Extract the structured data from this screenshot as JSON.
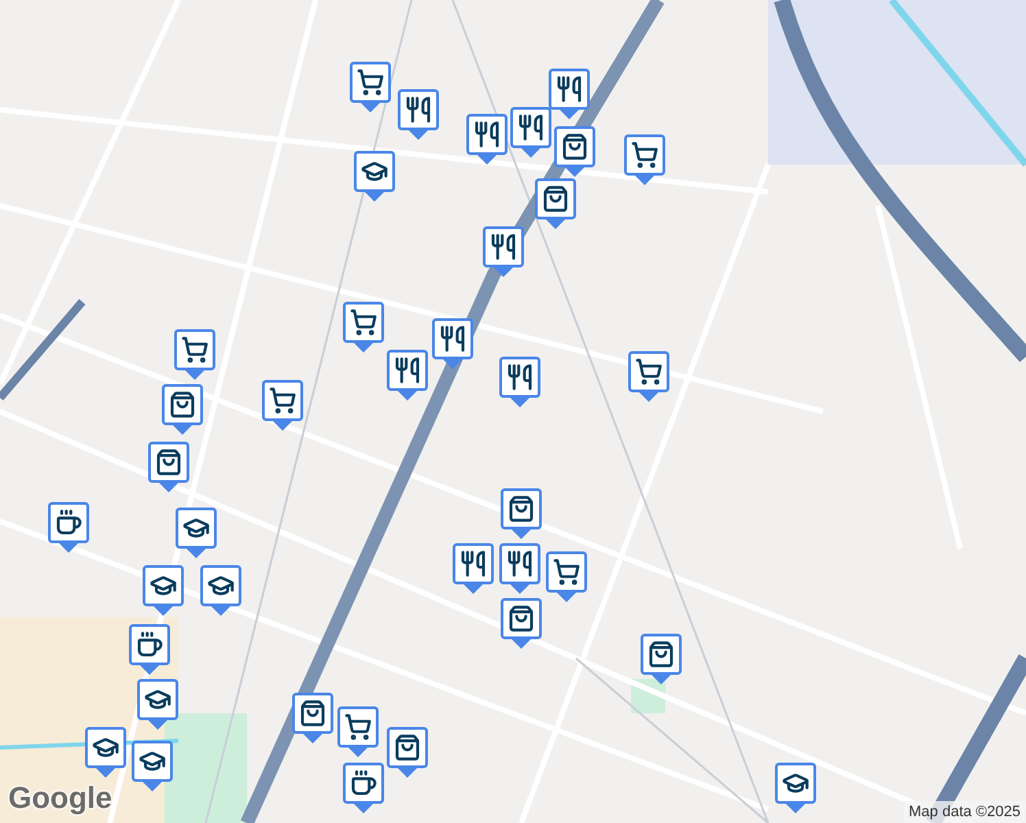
{
  "map": {
    "markers": [
      {
        "kind": "cart"
      },
      {
        "kind": "food"
      },
      {
        "kind": "food"
      },
      {
        "kind": "food"
      },
      {
        "kind": "food"
      },
      {
        "kind": "bag"
      },
      {
        "kind": "bag"
      },
      {
        "kind": "school"
      },
      {
        "kind": "cart"
      },
      {
        "kind": "food"
      },
      {
        "kind": "cart"
      },
      {
        "kind": "food"
      },
      {
        "kind": "food"
      },
      {
        "kind": "food"
      },
      {
        "kind": "cart"
      },
      {
        "kind": "cart"
      },
      {
        "kind": "cart"
      },
      {
        "kind": "bag"
      },
      {
        "kind": "bag"
      },
      {
        "kind": "cafe"
      },
      {
        "kind": "school"
      },
      {
        "kind": "school"
      },
      {
        "kind": "school"
      },
      {
        "kind": "cafe"
      },
      {
        "kind": "bag"
      },
      {
        "kind": "food"
      },
      {
        "kind": "food"
      },
      {
        "kind": "cart"
      },
      {
        "kind": "bag"
      },
      {
        "kind": "bag"
      },
      {
        "kind": "school"
      },
      {
        "kind": "school"
      },
      {
        "kind": "school"
      },
      {
        "kind": "bag"
      },
      {
        "kind": "cart"
      },
      {
        "kind": "bag"
      },
      {
        "kind": "cafe"
      },
      {
        "kind": "school"
      }
    ]
  },
  "attribution": {
    "logo": "Google",
    "text": "Map data ©2025"
  }
}
